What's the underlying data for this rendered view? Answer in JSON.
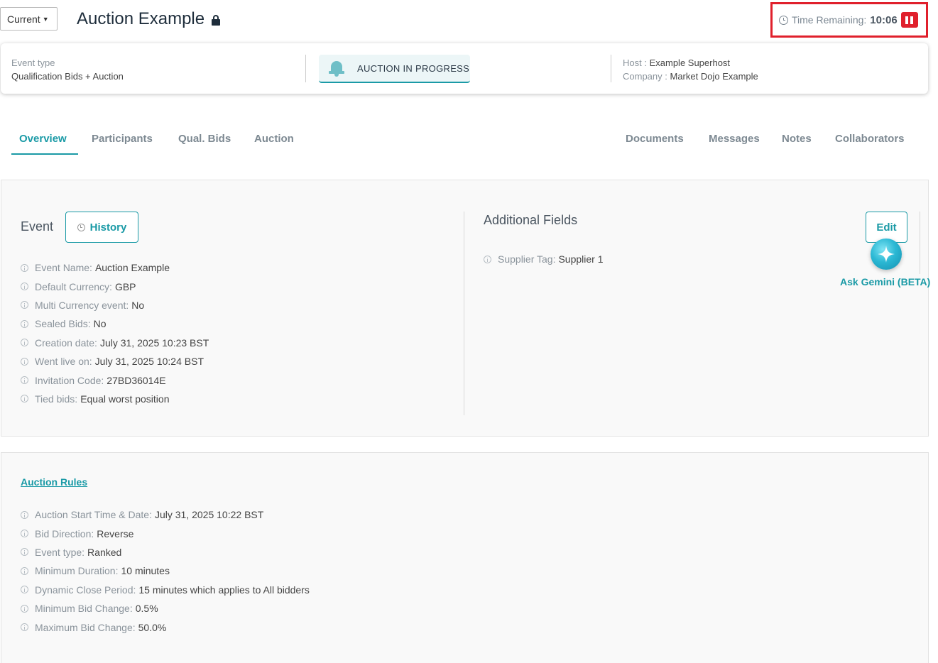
{
  "header": {
    "version_select": "Current",
    "title": "Auction Example",
    "timer_label": "Time Remaining:",
    "timer_value": "10:06"
  },
  "info_card": {
    "event_type_label": "Event type",
    "event_type_value": "Qualification Bids + Auction",
    "status": "AUCTION IN PROGRESS",
    "host_label": "Host :",
    "host_value": "Example Superhost",
    "company_label": "Company :",
    "company_value": "Market Dojo Example"
  },
  "tabs_left": [
    "Overview",
    "Participants",
    "Qual. Bids",
    "Auction"
  ],
  "tabs_right": [
    "Documents",
    "Messages",
    "Notes",
    "Collaborators"
  ],
  "event_section": {
    "title": "Event",
    "history_label": "History",
    "fields": [
      {
        "label": "Event Name:",
        "value": "Auction Example"
      },
      {
        "label": "Default Currency:",
        "value": "GBP"
      },
      {
        "label": "Multi Currency event:",
        "value": "No"
      },
      {
        "label": "Sealed Bids:",
        "value": "No"
      },
      {
        "label": "Creation date:",
        "value": "July 31, 2025 10:23 BST"
      },
      {
        "label": "Went live on:",
        "value": "July 31, 2025 10:24 BST"
      },
      {
        "label": "Invitation Code:",
        "value": "27BD36014E"
      },
      {
        "label": "Tied bids:",
        "value": "Equal worst position"
      }
    ]
  },
  "additional_fields": {
    "title": "Additional Fields",
    "edit_label": "Edit",
    "fields": [
      {
        "label": "Supplier Tag:",
        "value": "Supplier 1"
      }
    ]
  },
  "gemini": {
    "label": "Ask Gemini (BETA)"
  },
  "auction_rules": {
    "link": "Auction Rules",
    "fields": [
      {
        "label": "Auction Start Time & Date:",
        "value": "July 31, 2025 10:22 BST"
      },
      {
        "label": "Bid Direction:",
        "value": "Reverse"
      },
      {
        "label": "Event type:",
        "value": "Ranked"
      },
      {
        "label": "Minimum Duration:",
        "value": "10 minutes"
      },
      {
        "label": "Dynamic Close Period:",
        "value": "15 minutes which applies to All bidders"
      },
      {
        "label": "Minimum Bid Change:",
        "value": "0.5%"
      },
      {
        "label": "Maximum Bid Change:",
        "value": "50.0%"
      }
    ]
  },
  "colors": {
    "accent": "#1a9aa6",
    "alert": "#e0202c"
  }
}
